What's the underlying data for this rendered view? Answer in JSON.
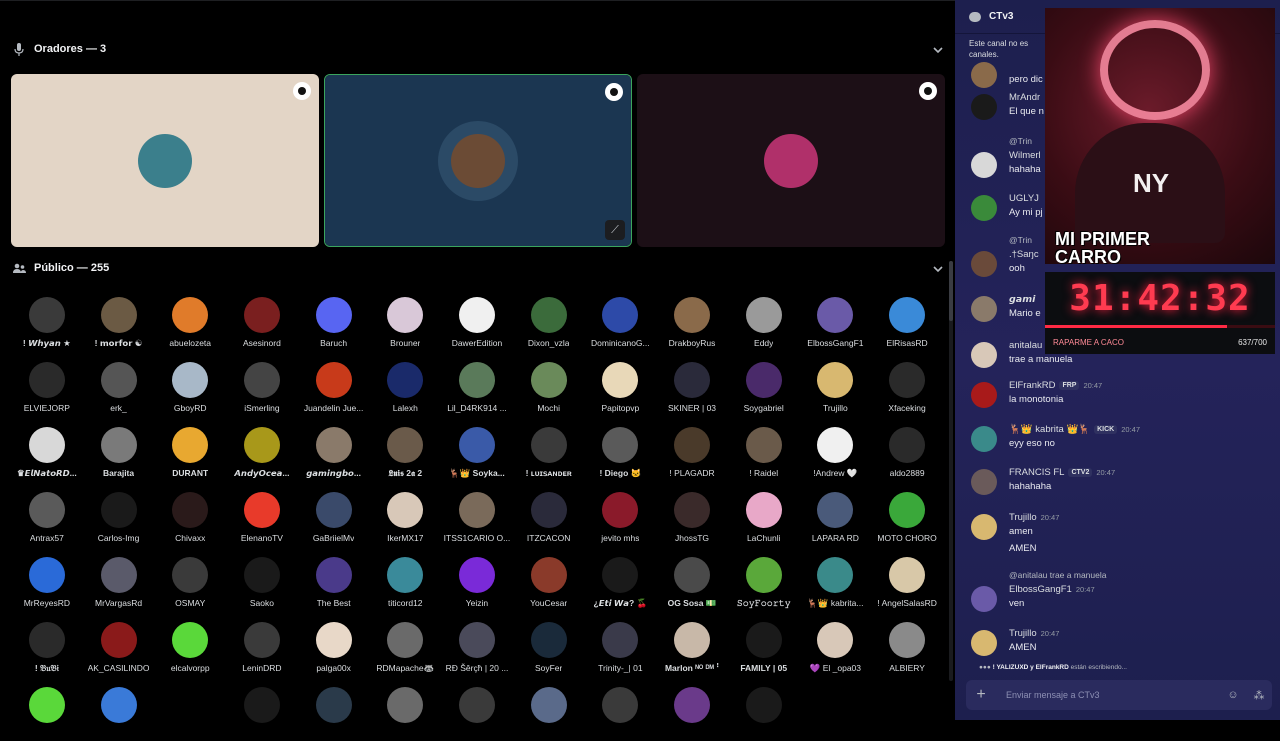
{
  "stage": {
    "speakers_header": "Oradores — 3",
    "audience_header": "Público — 255",
    "speaker_tiles": [
      {
        "bg": "#e3d5c6",
        "avatar": "#3b7f8c"
      },
      {
        "bg": "#1b3651",
        "avatar": "#6b4b35"
      },
      {
        "bg": "#1c0f16",
        "avatar": "#b0306a"
      }
    ],
    "audience": [
      {
        "name": "! 𝙒𝙝𝙮𝙖𝙣 ★",
        "color": "#3a3a3a",
        "bold": true
      },
      {
        "name": "! 𝗺𝗼𝗿𝗳𝗼𝗿 ☯",
        "color": "#6b5a44",
        "bold": true
      },
      {
        "name": "abuelozeta",
        "color": "#e07b2a"
      },
      {
        "name": "Asesinord",
        "color": "#7a1f1f"
      },
      {
        "name": "Baruch",
        "color": "#5865f2"
      },
      {
        "name": "Brouner",
        "color": "#d9c8d8"
      },
      {
        "name": "DawerEdition",
        "color": "#f0f0f0"
      },
      {
        "name": "Dixon_vzla",
        "color": "#3b6b3b"
      },
      {
        "name": "DominicanoG...",
        "color": "#2d4aa8"
      },
      {
        "name": "DrakboyRus",
        "color": "#8a6a4a"
      },
      {
        "name": "Eddy",
        "color": "#9a9a9a"
      },
      {
        "name": "ElbossGangF1",
        "color": "#6a5aa8"
      },
      {
        "name": "ElRisasRD",
        "color": "#3a8ad8"
      },
      {
        "name": "ELVIEJORP",
        "color": "#2a2a2a"
      },
      {
        "name": "erk_",
        "color": "#555"
      },
      {
        "name": "GboyRD",
        "color": "#a8b8c8"
      },
      {
        "name": "iSmerling",
        "color": "#444"
      },
      {
        "name": "Juandelin Jue...",
        "color": "#c83a1a"
      },
      {
        "name": "Lalexh",
        "color": "#1a2a6a"
      },
      {
        "name": "Lil_D4RK914 ...",
        "color": "#5a7a5a"
      },
      {
        "name": "Mochi",
        "color": "#6a8a5a"
      },
      {
        "name": "Papitopvp",
        "color": "#e8d8b8"
      },
      {
        "name": "SKINER | 03",
        "color": "#2a2a3a"
      },
      {
        "name": "Soygabriel",
        "color": "#4a2a6a"
      },
      {
        "name": "Trujillo",
        "color": "#d8b870"
      },
      {
        "name": "Xfaceking",
        "color": "#2a2a2a"
      },
      {
        "name": "♛𝙀𝙡𝙉𝙖𝙩𝙤𝙍𝘿...",
        "color": "#d8d8d8",
        "bold": true
      },
      {
        "name": "Barajita",
        "color": "#7a7a7a",
        "bold": true
      },
      {
        "name": "DURANT",
        "color": "#e8a830",
        "bold": true
      },
      {
        "name": "𝘼𝙣𝙙𝙮𝙊𝙘𝙚𝙖...",
        "color": "#a8981a",
        "bold": true
      },
      {
        "name": "𝙜𝙖𝙢𝙞𝙣𝙜𝙗𝙤...",
        "color": "#8a7a6a",
        "bold": true
      },
      {
        "name": "𝕷𝖚𝖎𝖘 2𝖆 2",
        "color": "#6a5a4a",
        "bold": true
      },
      {
        "name": "🦌👑 Soyka...",
        "color": "#3a5aa8",
        "bold": true
      },
      {
        "name": "! ʟᴜɪꜱᴀɴᴅᴇʀ",
        "color": "#3a3a3a",
        "bold": true
      },
      {
        "name": "! Diego 🐱",
        "color": "#5a5a5a",
        "bold": true
      },
      {
        "name": "! PLAGADR",
        "color": "#4a3a2a"
      },
      {
        "name": "! Raidel",
        "color": "#6a5a4a"
      },
      {
        "name": "!Andrew 🤍",
        "color": "#f0f0f0"
      },
      {
        "name": "aldo2889",
        "color": "#2a2a2a"
      },
      {
        "name": "Antrax57",
        "color": "#5a5a5a"
      },
      {
        "name": "Carlos-Img",
        "color": "#1a1a1a"
      },
      {
        "name": "Chivaxx",
        "color": "#2a1a1a"
      },
      {
        "name": "ElenanoTV",
        "color": "#e83a2a"
      },
      {
        "name": "GaBriielMv",
        "color": "#3a4a6a"
      },
      {
        "name": "IkerMX17",
        "color": "#d8c8b8"
      },
      {
        "name": "ITSS1CARIO O...",
        "color": "#7a6a5a"
      },
      {
        "name": "ITZCACON",
        "color": "#2a2a3a"
      },
      {
        "name": "jevito mhs",
        "color": "#8a1a2a"
      },
      {
        "name": "JhossTG",
        "color": "#3a2a2a"
      },
      {
        "name": "LaChunli",
        "color": "#e8a8c8"
      },
      {
        "name": "LAPARA RD",
        "color": "#4a5a7a"
      },
      {
        "name": "MOTO CHORO",
        "color": "#3aa83a"
      },
      {
        "name": "MrReyesRD",
        "color": "#2a6ad8"
      },
      {
        "name": "MrVargasRd",
        "color": "#5a5a6a"
      },
      {
        "name": "OSMAY",
        "color": "#3a3a3a"
      },
      {
        "name": "Saoko",
        "color": "#1a1a1a"
      },
      {
        "name": "The Best",
        "color": "#4a3a8a"
      },
      {
        "name": "titicord12",
        "color": "#3a8a9a"
      },
      {
        "name": "Yeizin",
        "color": "#7a2ad8"
      },
      {
        "name": "YouCesar",
        "color": "#8a3a2a"
      },
      {
        "name": "¿𝙀𝙩𝙞 𝙒𝙖? 🍒",
        "color": "#1a1a1a",
        "bold": true
      },
      {
        "name": "OG Sosa 💵",
        "color": "#4a4a4a",
        "bold": true
      },
      {
        "name": "𝚂𝚘𝚢𝙵𝚘𝚘𝚛𝚝𝚢",
        "color": "#5aa83a",
        "bold": true
      },
      {
        "name": "🦌👑 kabrita...",
        "color": "#3a8a8a"
      },
      {
        "name": "! AngelSalasRD",
        "color": "#d8c8a8"
      },
      {
        "name": "! 𝔅𝔲𝔅𝔦",
        "color": "#2a2a2a",
        "bold": true
      },
      {
        "name": "AK_CASILINDO",
        "color": "#8a1a1a"
      },
      {
        "name": "elcalvorpp",
        "color": "#5ad83a"
      },
      {
        "name": "LeninDRD",
        "color": "#3a3a3a"
      },
      {
        "name": "palga00x",
        "color": "#e8d8c8"
      },
      {
        "name": "RDMapache🦝",
        "color": "#6a6a6a"
      },
      {
        "name": "RĐ Šêrçħ | 20 ...",
        "color": "#4a4a5a"
      },
      {
        "name": "SoyFer",
        "color": "#1a2a3a"
      },
      {
        "name": "Trinity-_| 01",
        "color": "#3a3a4a"
      },
      {
        "name": "Marlon ᴺᴼ ᴰᴹ ꜝ",
        "color": "#c8b8a8",
        "bold": true
      },
      {
        "name": "FAMILY | 05",
        "color": "#1a1a1a",
        "bold": true
      },
      {
        "name": "💜 El _opa03",
        "color": "#d8c8b8"
      },
      {
        "name": "ALBIERY",
        "color": "#8a8a8a"
      },
      {
        "name": "",
        "color": "#5ad83a"
      },
      {
        "name": "",
        "color": "#3a7ad8"
      },
      {
        "name": "",
        "color": "#000000"
      },
      {
        "name": "",
        "color": "#1a1a1a"
      },
      {
        "name": "",
        "color": "#2a3a4a"
      },
      {
        "name": "",
        "color": "#6a6a6a"
      },
      {
        "name": "",
        "color": "#3a3a3a"
      },
      {
        "name": "",
        "color": "#5a6a8a"
      },
      {
        "name": "",
        "color": "#3a3a3a"
      },
      {
        "name": "",
        "color": "#6a3a8a"
      },
      {
        "name": "",
        "color": "#1a1a1a"
      }
    ]
  },
  "chat": {
    "channel": "CTv3",
    "notice": "Este canal no es canales.",
    "placeholder": "Enviar mensaje a CTv3",
    "typing_users": "! YALIZUXD y ElFrankRD",
    "typing_text": " están escribiendo...",
    "messages": [
      {
        "name": "",
        "time": "",
        "text": "pero dic",
        "color": "#8a6a4a"
      },
      {
        "name": "MrAndr",
        "time": "",
        "text": "El que n",
        "color": "#1a1a1a"
      },
      {
        "reply": "@Trin",
        "name": "Wilmerl",
        "time": "",
        "text": "hahaha",
        "color": "#d8d8d8"
      },
      {
        "name": "UGLYJ",
        "time": "",
        "text": "Ay mi pj",
        "color": "#3a8a3a"
      },
      {
        "reply": "@Trin",
        "name": ".†Saŋc",
        "time": "",
        "text": "ooh",
        "color": "#6a4a3a"
      },
      {
        "name": "𝙜𝙖𝙢𝙞",
        "time": "",
        "text": "Mario e",
        "color": "#8a7a6a"
      },
      {
        "name": "anitalau",
        "time": "",
        "text": "trae a manuela",
        "color": "#d8c8b8"
      },
      {
        "name": "ElFrankRD",
        "tag": "FRP",
        "time": "20:47",
        "text": "la monotonia",
        "color": "#a81a1a"
      },
      {
        "name": "🦌👑 kabrita 👑🦌",
        "tag": "KICK",
        "time": "20:47",
        "text": "eyy eso no",
        "color": "#3a8a8a"
      },
      {
        "name": "FRANCIS FL",
        "tag": "CTV2",
        "time": "20:47",
        "text": "hahahaha",
        "color": "#6a5a5a"
      },
      {
        "name": "Trujillo",
        "time": "20:47",
        "text": "amen",
        "text2": "AMEN",
        "color": "#d8b870"
      },
      {
        "reply": "@anitalau  trae a manuela",
        "name": "ElbossGangF1",
        "time": "20:47",
        "text": "ven",
        "color": "#6a5aa8"
      },
      {
        "name": "Trujillo",
        "time": "20:47",
        "text": "AMEN",
        "color": "#d8b870"
      }
    ]
  },
  "overlay": {
    "title_line1": "MI PRIMER",
    "title_line2": "CARRO",
    "logo": "NY",
    "timer": "31:42:32",
    "progress": 0.79,
    "timer_label": "RAPARME A CACO",
    "count": "637/700"
  }
}
